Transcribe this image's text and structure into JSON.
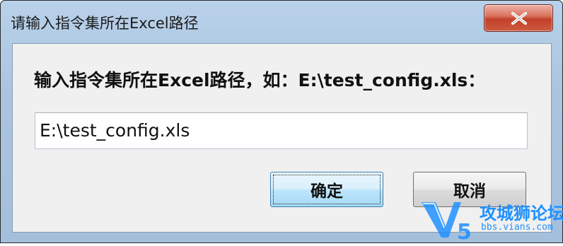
{
  "window": {
    "title": "请输入指令集所在Excel路径",
    "close_icon": "close-icon"
  },
  "dialog": {
    "prompt": "输入指令集所在Excel路径，如：E:\\test_config.xls：",
    "path_value": "E:\\test_config.xls",
    "ok_label": "确定",
    "cancel_label": "取消"
  },
  "watermark": {
    "brand": "攻城狮论坛",
    "url": "bbs.vians.com",
    "logo": "V5"
  },
  "colors": {
    "title_bar": "#aac4e0",
    "close_button": "#c2412a",
    "client_bg": "#f0f0f0",
    "watermark": "#1e90ff"
  }
}
